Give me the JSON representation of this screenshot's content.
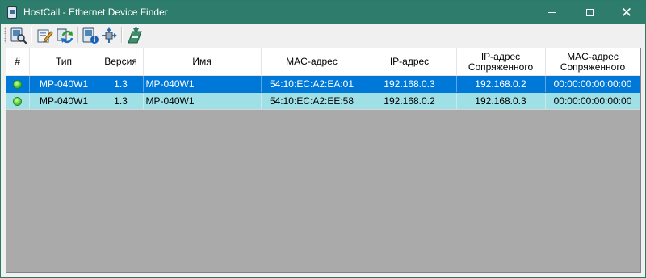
{
  "window": {
    "title": "HostCall - Ethernet Device Finder",
    "icon": "app-window-icon"
  },
  "toolbar": {
    "buttons": [
      {
        "name": "search-device-button",
        "icon": "monitor-search-icon"
      },
      {
        "name": "edit-settings-button",
        "icon": "edit-document-icon"
      },
      {
        "name": "refresh-button",
        "icon": "refresh-arrows-icon"
      },
      {
        "name": "device-info-button",
        "icon": "device-info-icon"
      },
      {
        "name": "connect-button",
        "icon": "connect-plug-icon"
      },
      {
        "name": "exit-button",
        "icon": "exit-icon"
      }
    ]
  },
  "colors": {
    "titlebar": "#2d7c6c",
    "selected_row": "#0078d7",
    "alt_row": "#9fe0e6",
    "status_online": "#55d040"
  },
  "table": {
    "columns": [
      "#",
      "Тип",
      "Версия",
      "Имя",
      "MAC-адрес",
      "IP-адрес",
      "IP-адрес Сопряженного",
      "MAC-адрес Сопряженного"
    ],
    "columns_split": {
      "ip_pair_line1": "IP-адрес",
      "ip_pair_line2": "Сопряженного",
      "mac_pair_line1": "MAC-адрес",
      "mac_pair_line2": "Сопряженного"
    },
    "rows": [
      {
        "status": "online",
        "type": "MP-040W1",
        "version": "1.3",
        "name": "MP-040W1",
        "mac": "54:10:EC:A2:EA:01",
        "ip": "192.168.0.3",
        "pair_ip": "192.168.0.2",
        "pair_mac": "00:00:00:00:00:00"
      },
      {
        "status": "online",
        "type": "MP-040W1",
        "version": "1.3",
        "name": "MP-040W1",
        "mac": "54:10:EC:A2:EE:58",
        "ip": "192.168.0.2",
        "pair_ip": "192.168.0.3",
        "pair_mac": "00:00:00:00:00:00"
      }
    ]
  }
}
